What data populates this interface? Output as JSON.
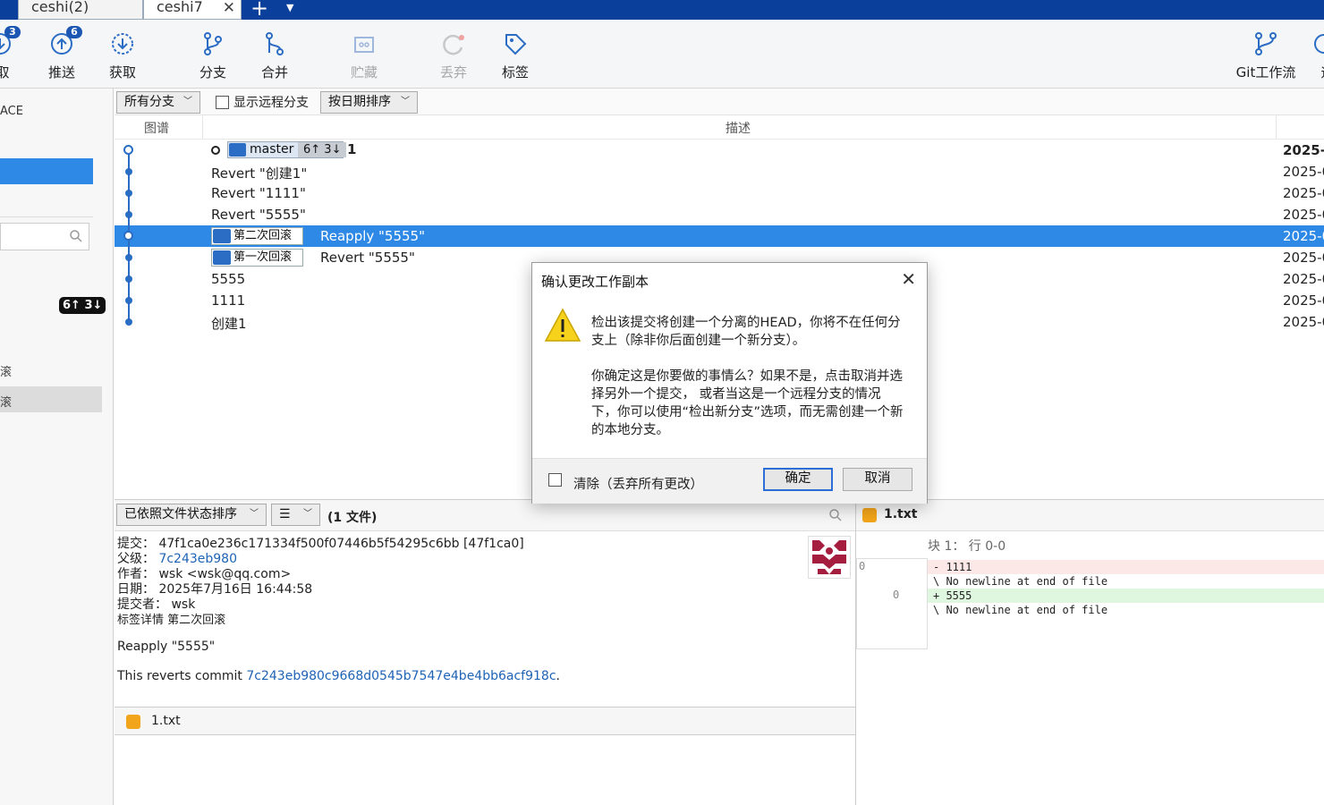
{
  "tabs": [
    {
      "label": "ceshi(2)",
      "active": false
    },
    {
      "label": "ceshi7",
      "active": true
    }
  ],
  "tab_close": "✕",
  "add_tab": "+",
  "tab_menu": "▼",
  "toolbar": {
    "fetch_partial": {
      "label": "取",
      "badge": "3"
    },
    "push": {
      "label": "推送",
      "badge": "6"
    },
    "pull": {
      "label": "获取"
    },
    "branch": {
      "label": "分支"
    },
    "merge": {
      "label": "合并"
    },
    "stash": {
      "label": "贮藏",
      "disabled": true
    },
    "discard": {
      "label": "丢弃",
      "disabled": true
    },
    "tag": {
      "label": "标签"
    },
    "gitflow": {
      "label": "Git工作流"
    },
    "remote_partial": {
      "label": "远"
    }
  },
  "sidebar": {
    "workspace_label": "ACE",
    "branch_badge": "6↑ 3↓",
    "item1": "滚",
    "item2": "滚"
  },
  "filter": {
    "all_branches": "所有分支",
    "show_remote": "显示远程分支",
    "sort": "按日期排序"
  },
  "columns": {
    "graph": "图谱",
    "description": "描述"
  },
  "commits": [
    {
      "msg": "1",
      "branch": "master",
      "counts": "6↑ 3↓",
      "date": "2025-0"
    },
    {
      "msg": "Revert \"创建1\"",
      "date": "2025-0"
    },
    {
      "msg": "Revert \"1111\"",
      "date": "2025-0"
    },
    {
      "msg": "Revert \"5555\"",
      "date": "2025-0"
    },
    {
      "msg": "Reapply \"5555\"",
      "tag": "第二次回滚",
      "date": "2025-0",
      "selected": true
    },
    {
      "msg": "Revert \"5555\"",
      "tag": "第一次回滚",
      "date": "2025-0"
    },
    {
      "msg": "5555",
      "date": "2025-0"
    },
    {
      "msg": "1111",
      "date": "2025-0"
    },
    {
      "msg": "创建1",
      "date": "2025-0"
    }
  ],
  "bottom": {
    "sort_files": "已依照文件状态排序",
    "list_mode": "☰",
    "file_count": "(1 文件)"
  },
  "detail": {
    "commit_label": "提交：",
    "commit_value": "47f1ca0e236c171334f500f07446b5f54295c6bb [47f1ca0]",
    "parent_label": "父级：",
    "parent_value": "7c243eb980",
    "author_label": "作者：",
    "author_value": "wsk <wsk@qq.com>",
    "date_label": "日期：",
    "date_value": "2025年7月16日 16:44:58",
    "committer_label": "提交者：",
    "committer_value": "wsk",
    "tag_label": "标签详情",
    "tag_value": "第二次回滚",
    "message": "Reapply \"5555\"",
    "reverts_prefix": "This reverts commit ",
    "reverts_hash": "7c243eb980c9668d0545b7547e4be4bb6acf918c",
    "reverts_suffix": "."
  },
  "files": [
    {
      "name": "1.txt"
    }
  ],
  "diff": {
    "file": "1.txt",
    "hunk": "块 1： 行 0-0",
    "gutter_old": "0",
    "gutter_new": "0",
    "lines": [
      {
        "type": "del",
        "text": "- 1111"
      },
      {
        "type": "ctx",
        "text": "\\  No newline at end of file"
      },
      {
        "type": "add",
        "text": "+ 5555"
      },
      {
        "type": "ctx",
        "text": "\\  No newline at end of file"
      }
    ]
  },
  "dialog": {
    "title": "确认更改工作副本",
    "close": "✕",
    "line1": "检出该提交将创建一个分离的HEAD，你将不在任何分",
    "line2": "支上（除非你后面创建一个新分支）。",
    "line3": "你确定这是你要做的事情么？如果不是，点击取消并选",
    "line4": "择另外一个提交， 或者当这是一个远程分支的情况",
    "line5": "下，你可以使用“检出新分支”选项，而无需创建一个新",
    "line6": "的本地分支。",
    "discard_label": "清除（丢弃所有更改）",
    "ok": "确定",
    "cancel": "取消"
  },
  "colors": {
    "accent": "#2e89e6",
    "tabbar": "#0a3f9c",
    "graph": "#2b6cc4"
  }
}
